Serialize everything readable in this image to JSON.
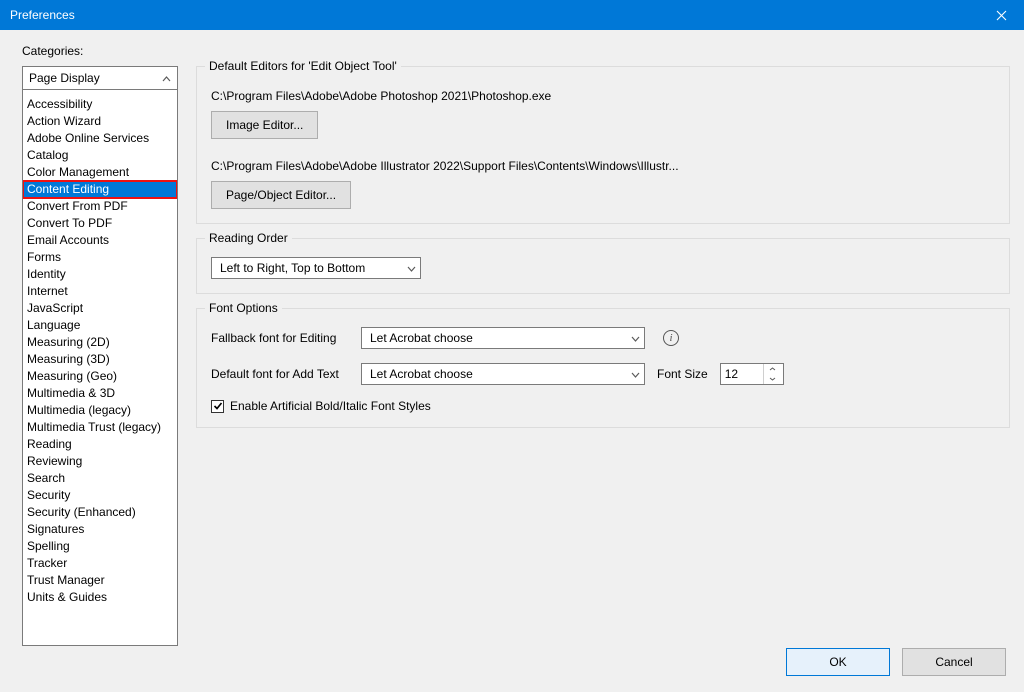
{
  "window": {
    "title": "Preferences"
  },
  "categories_label": "Categories:",
  "categories_top": "Page Display",
  "categories": [
    "Accessibility",
    "Action Wizard",
    "Adobe Online Services",
    "Catalog",
    "Color Management",
    "Content Editing",
    "Convert From PDF",
    "Convert To PDF",
    "Email Accounts",
    "Forms",
    "Identity",
    "Internet",
    "JavaScript",
    "Language",
    "Measuring (2D)",
    "Measuring (3D)",
    "Measuring (Geo)",
    "Multimedia & 3D",
    "Multimedia (legacy)",
    "Multimedia Trust (legacy)",
    "Reading",
    "Reviewing",
    "Search",
    "Security",
    "Security (Enhanced)",
    "Signatures",
    "Spelling",
    "Tracker",
    "Trust Manager",
    "Units & Guides"
  ],
  "selected_category_index": 5,
  "editors": {
    "group_title": "Default Editors for 'Edit Object Tool'",
    "image_path": "C:\\Program Files\\Adobe\\Adobe Photoshop 2021\\Photoshop.exe",
    "image_button": "Image Editor...",
    "page_path": "C:\\Program Files\\Adobe\\Adobe Illustrator 2022\\Support Files\\Contents\\Windows\\Illustr...",
    "page_button": "Page/Object Editor..."
  },
  "reading_order": {
    "group_title": "Reading Order",
    "value": "Left to Right, Top to Bottom"
  },
  "font_options": {
    "group_title": "Font Options",
    "fallback_label": "Fallback font for Editing",
    "fallback_value": "Let Acrobat choose",
    "addtext_label": "Default font for Add Text",
    "addtext_value": "Let Acrobat choose",
    "fontsize_label": "Font Size",
    "fontsize_value": "12",
    "artificial_label": "Enable Artificial Bold/Italic Font Styles",
    "artificial_checked": true
  },
  "buttons": {
    "ok": "OK",
    "cancel": "Cancel"
  }
}
